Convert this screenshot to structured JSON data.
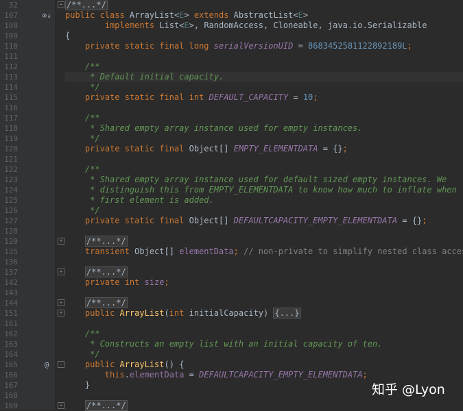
{
  "lines": [
    {
      "n": "32",
      "fold": "+",
      "segs": [
        {
          "t": "/**...*/",
          "c": "collapsed"
        }
      ]
    },
    {
      "n": "107",
      "mark": "⊙↓",
      "segs": [
        {
          "t": "public class ",
          "c": "kw"
        },
        {
          "t": "ArrayList<"
        },
        {
          "t": "E",
          "c": "typ"
        },
        {
          "t": "> "
        },
        {
          "t": "extends ",
          "c": "kw"
        },
        {
          "t": "AbstractList<"
        },
        {
          "t": "E",
          "c": "typ"
        },
        {
          "t": ">"
        }
      ]
    },
    {
      "n": "108",
      "segs": [
        {
          "t": "        "
        },
        {
          "t": "implements ",
          "c": "kw"
        },
        {
          "t": "List<"
        },
        {
          "t": "E",
          "c": "typ"
        },
        {
          "t": ">, RandomAccess, Cloneable, java.io.Serializable"
        }
      ]
    },
    {
      "n": "109",
      "segs": [
        {
          "t": "{"
        }
      ]
    },
    {
      "n": "110",
      "segs": [
        {
          "t": "    "
        },
        {
          "t": "private static final long ",
          "c": "kw"
        },
        {
          "t": "serialVersionUID",
          "c": "fld"
        },
        {
          "t": " = "
        },
        {
          "t": "8683452581122892189L",
          "c": "num"
        },
        {
          "t": ";",
          "c": "kw"
        }
      ]
    },
    {
      "n": "111",
      "segs": []
    },
    {
      "n": "112",
      "segs": [
        {
          "t": "    /**",
          "c": "doc"
        }
      ]
    },
    {
      "n": "113",
      "hl": true,
      "segs": [
        {
          "t": "     * Default initial capacity.",
          "c": "doc"
        }
      ]
    },
    {
      "n": "114",
      "segs": [
        {
          "t": "     */",
          "c": "doc"
        }
      ]
    },
    {
      "n": "115",
      "segs": [
        {
          "t": "    "
        },
        {
          "t": "private static final int ",
          "c": "kw"
        },
        {
          "t": "DEFAULT_CAPACITY",
          "c": "fld"
        },
        {
          "t": " = "
        },
        {
          "t": "10",
          "c": "num"
        },
        {
          "t": ";",
          "c": "kw"
        }
      ]
    },
    {
      "n": "116",
      "segs": []
    },
    {
      "n": "117",
      "segs": [
        {
          "t": "    /**",
          "c": "doc"
        }
      ]
    },
    {
      "n": "118",
      "segs": [
        {
          "t": "     * Shared empty array instance used for empty instances.",
          "c": "doc"
        }
      ]
    },
    {
      "n": "119",
      "segs": [
        {
          "t": "     */",
          "c": "doc"
        }
      ]
    },
    {
      "n": "120",
      "segs": [
        {
          "t": "    "
        },
        {
          "t": "private static final ",
          "c": "kw"
        },
        {
          "t": "Object[] "
        },
        {
          "t": "EMPTY_ELEMENTDATA",
          "c": "fld"
        },
        {
          "t": " = {}"
        },
        {
          "t": ";",
          "c": "kw"
        }
      ]
    },
    {
      "n": "121",
      "segs": []
    },
    {
      "n": "122",
      "segs": [
        {
          "t": "    /**",
          "c": "doc"
        }
      ]
    },
    {
      "n": "123",
      "segs": [
        {
          "t": "     * Shared empty array instance used for default sized empty instances. We",
          "c": "doc"
        }
      ]
    },
    {
      "n": "124",
      "segs": [
        {
          "t": "     * distinguish this from EMPTY_ELEMENTDATA to know how much to inflate when",
          "c": "doc"
        }
      ]
    },
    {
      "n": "125",
      "segs": [
        {
          "t": "     * first element is added.",
          "c": "doc"
        }
      ]
    },
    {
      "n": "126",
      "segs": [
        {
          "t": "     */",
          "c": "doc"
        }
      ]
    },
    {
      "n": "127",
      "segs": [
        {
          "t": "    "
        },
        {
          "t": "private static final ",
          "c": "kw"
        },
        {
          "t": "Object[] "
        },
        {
          "t": "DEFAULTCAPACITY_EMPTY_ELEMENTDATA",
          "c": "fld"
        },
        {
          "t": " = {}"
        },
        {
          "t": ";",
          "c": "kw"
        }
      ]
    },
    {
      "n": "128",
      "segs": []
    },
    {
      "n": "129",
      "fold": "+",
      "segs": [
        {
          "t": "    "
        },
        {
          "t": "/**...*/",
          "c": "collapsed"
        }
      ]
    },
    {
      "n": "135",
      "segs": [
        {
          "t": "    "
        },
        {
          "t": "transient ",
          "c": "kw"
        },
        {
          "t": "Object[] "
        },
        {
          "t": "elementData",
          "c": "ifld"
        },
        {
          "t": "; ",
          "c": "kw"
        },
        {
          "t": "// non-private to simplify nested class access",
          "c": "cmt"
        }
      ]
    },
    {
      "n": "136",
      "segs": []
    },
    {
      "n": "137",
      "fold": "+",
      "segs": [
        {
          "t": "    "
        },
        {
          "t": "/**...*/",
          "c": "collapsed"
        }
      ]
    },
    {
      "n": "142",
      "segs": [
        {
          "t": "    "
        },
        {
          "t": "private int ",
          "c": "kw"
        },
        {
          "t": "size",
          "c": "ifld"
        },
        {
          "t": ";",
          "c": "kw"
        }
      ]
    },
    {
      "n": "143",
      "segs": []
    },
    {
      "n": "144",
      "fold": "+",
      "segs": [
        {
          "t": "    "
        },
        {
          "t": "/**...*/",
          "c": "collapsed"
        }
      ]
    },
    {
      "n": "151",
      "fold": "+",
      "segs": [
        {
          "t": "    "
        },
        {
          "t": "public ",
          "c": "kw"
        },
        {
          "t": "ArrayList",
          "c": "mth"
        },
        {
          "t": "("
        },
        {
          "t": "int ",
          "c": "kw"
        },
        {
          "t": "initialCapacity) "
        },
        {
          "t": "{...}",
          "c": "collapsed"
        }
      ]
    },
    {
      "n": "161",
      "segs": []
    },
    {
      "n": "162",
      "segs": [
        {
          "t": "    /**",
          "c": "doc"
        }
      ]
    },
    {
      "n": "163",
      "segs": [
        {
          "t": "     * Constructs an empty list with an initial capacity of ten.",
          "c": "doc"
        }
      ]
    },
    {
      "n": "164",
      "segs": [
        {
          "t": "     */",
          "c": "doc"
        }
      ]
    },
    {
      "n": "165",
      "mark": "@",
      "fold": "-",
      "segs": [
        {
          "t": "    "
        },
        {
          "t": "public ",
          "c": "kw"
        },
        {
          "t": "ArrayList",
          "c": "mth"
        },
        {
          "t": "() {"
        }
      ]
    },
    {
      "n": "166",
      "segs": [
        {
          "t": "        "
        },
        {
          "t": "this",
          "c": "kw"
        },
        {
          "t": "."
        },
        {
          "t": "elementData",
          "c": "ifld"
        },
        {
          "t": " = "
        },
        {
          "t": "DEFAULTCAPACITY_EMPTY_ELEMENTDATA",
          "c": "fld"
        },
        {
          "t": ";",
          "c": "kw"
        }
      ]
    },
    {
      "n": "167",
      "segs": [
        {
          "t": "    }"
        }
      ]
    },
    {
      "n": "168",
      "segs": []
    },
    {
      "n": "169",
      "fold": "+",
      "segs": [
        {
          "t": "    "
        },
        {
          "t": "/**...*/",
          "c": "collapsed"
        }
      ]
    }
  ],
  "watermark": "知乎 @Lyon"
}
